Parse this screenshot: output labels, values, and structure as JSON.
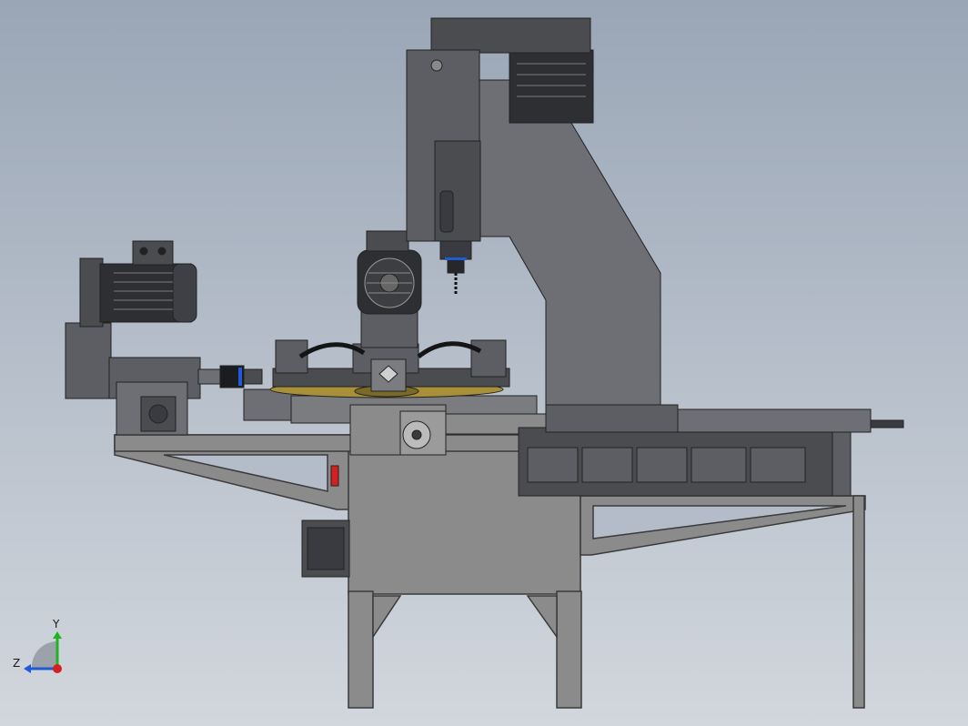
{
  "viewport": {
    "background_top": "#9aa6b6",
    "background_bottom": "#d2d7dd"
  },
  "colors": {
    "machine_dark": "#4a4c50",
    "machine_mid": "#5c5e63",
    "machine_light": "#6d6f74",
    "frame_gray": "#8b8b8b",
    "frame_edge": "#3a3a3a",
    "motor_black": "#2e2f33",
    "accent_blue": "#1f5bd6",
    "accent_red": "#d42020",
    "accent_green": "#21b421",
    "gold": "#a88f3a"
  },
  "triad": {
    "y_label": "Y",
    "z_label": "Z"
  },
  "icons": {
    "orientation": "view-orientation-triad-icon"
  }
}
